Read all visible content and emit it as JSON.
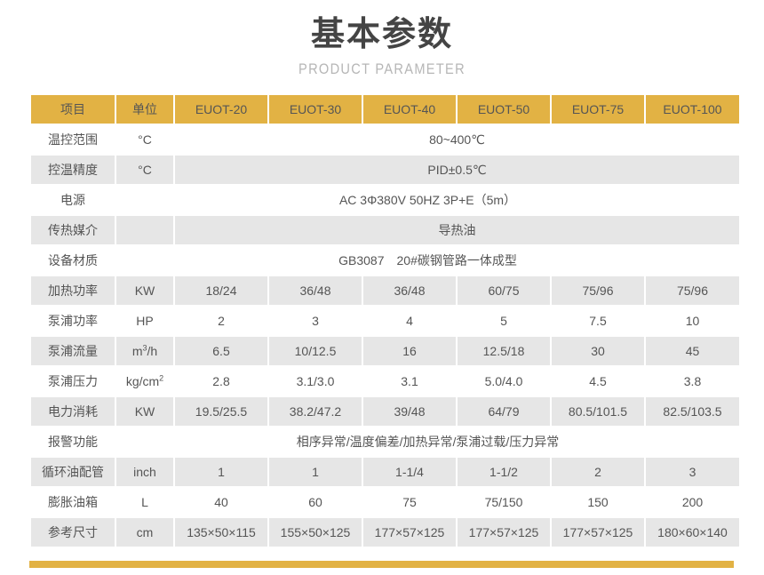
{
  "header": {
    "main_title": "基本参数",
    "sub_title": "PRODUCT PARAMETER"
  },
  "theme": {
    "accent": "#e2b244",
    "row_alt": "#e6e6e6",
    "text": "#555555",
    "title_text": "#444444",
    "subtitle_text": "#b6b6b6"
  },
  "table": {
    "columns": [
      {
        "key": "item",
        "label": "项目"
      },
      {
        "key": "unit",
        "label": "单位"
      },
      {
        "key": "m20",
        "label": "EUOT-20"
      },
      {
        "key": "m30",
        "label": "EUOT-30"
      },
      {
        "key": "m40",
        "label": "EUOT-40"
      },
      {
        "key": "m50",
        "label": "EUOT-50"
      },
      {
        "key": "m75",
        "label": "EUOT-75"
      },
      {
        "key": "m100",
        "label": "EUOT-100"
      }
    ],
    "rows": [
      {
        "label": "温控范围",
        "unit": "°C",
        "merged": true,
        "merged_value": "80~400℃",
        "values": []
      },
      {
        "label": "控温精度",
        "unit": "°C",
        "merged": true,
        "merged_value": "PID±0.5℃",
        "values": []
      },
      {
        "label": "电源",
        "unit": "",
        "merged": true,
        "merged_full": true,
        "merged_value": "AC 3Φ380V 50HZ 3P+E（5m）",
        "values": []
      },
      {
        "label": "传热媒介",
        "unit": "",
        "merged": true,
        "merged_value": "导热油",
        "values": []
      },
      {
        "label": "设备材质",
        "unit": "",
        "merged": true,
        "merged_full": true,
        "merged_value": "GB3087　20#碳钢管路一体成型",
        "values": []
      },
      {
        "label": "加热功率",
        "unit": "KW",
        "merged": false,
        "values": [
          "18/24",
          "36/48",
          "36/48",
          "60/75",
          "75/96",
          "75/96"
        ]
      },
      {
        "label": "泵浦功率",
        "unit": "HP",
        "merged": false,
        "values": [
          "2",
          "3",
          "4",
          "5",
          "7.5",
          "10"
        ]
      },
      {
        "label": "泵浦流量",
        "unit": "m³/h",
        "unit_base": "m",
        "unit_sup": "3",
        "unit_tail": "/h",
        "merged": false,
        "values": [
          "6.5",
          "10/12.5",
          "16",
          "12.5/18",
          "30",
          "45"
        ]
      },
      {
        "label": "泵浦压力",
        "unit": "kg/cm²",
        "unit_base": "kg/cm",
        "unit_sup": "2",
        "unit_tail": "",
        "merged": false,
        "values": [
          "2.8",
          "3.1/3.0",
          "3.1",
          "5.0/4.0",
          "4.5",
          "3.8"
        ]
      },
      {
        "label": "电力消耗",
        "unit": "KW",
        "merged": false,
        "values": [
          "19.5/25.5",
          "38.2/47.2",
          "39/48",
          "64/79",
          "80.5/101.5",
          "82.5/103.5"
        ]
      },
      {
        "label": "报警功能",
        "unit": "",
        "merged": true,
        "merged_full": true,
        "merged_value": "相序异常/温度偏差/加热异常/泵浦过载/压力异常",
        "values": []
      },
      {
        "label": "循环油配管",
        "unit": "inch",
        "merged": false,
        "values": [
          "1",
          "1",
          "1-1/4",
          "1-1/2",
          "2",
          "3"
        ]
      },
      {
        "label": "膨胀油箱",
        "unit": "L",
        "merged": false,
        "values": [
          "40",
          "60",
          "75",
          "75/150",
          "150",
          "200"
        ]
      },
      {
        "label": "参考尺寸",
        "unit": "cm",
        "merged": false,
        "values": [
          "135×50×115",
          "155×50×125",
          "177×57×125",
          "177×57×125",
          "177×57×125",
          "180×60×140"
        ]
      }
    ]
  }
}
